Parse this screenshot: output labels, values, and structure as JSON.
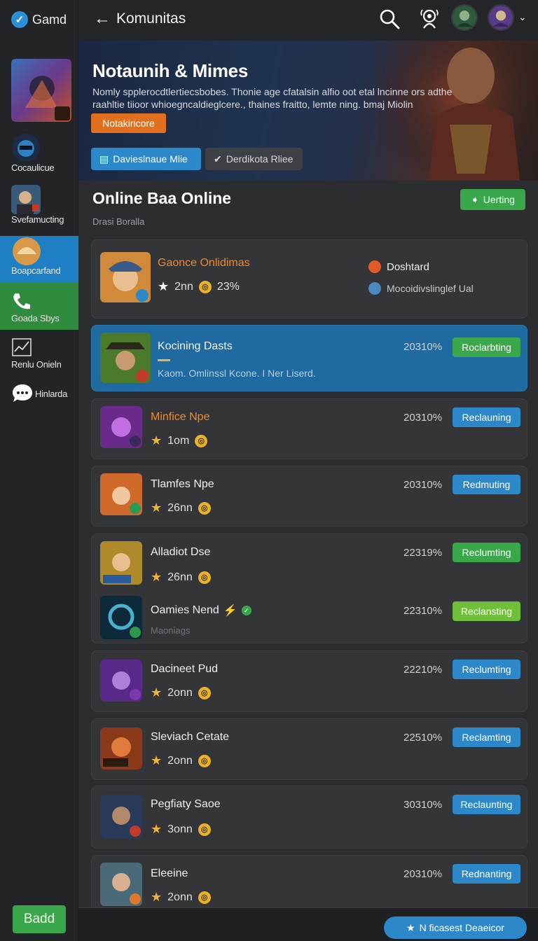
{
  "app": {
    "brand": "Gamd"
  },
  "sidebar": {
    "items": [
      {
        "label": ""
      },
      {
        "label": "Cocaulicue"
      },
      {
        "label": "Svefamucting"
      },
      {
        "label": "Boapcarfand"
      },
      {
        "label": "Goada Sbys"
      },
      {
        "label": "Renlu Onieln"
      },
      {
        "label": "Hinlarda"
      }
    ],
    "bottom_button": "Badd"
  },
  "header": {
    "title": "Komunitas"
  },
  "hero": {
    "title": "Notaunih & Mimes",
    "description": "Nomly spplerocdtlertiecsbobes. Thonie age cfatalsin alfio oot etal lncinne ors adthe raahltie tiioor whioegncaldieglcere., thaines fraitto, lemte ning. bmaj Miolin",
    "tag": "Notakiricore",
    "button_primary": "Davieslnaue Mlie",
    "button_secondary": "Derdikota Rliee"
  },
  "section": {
    "title": "Online Baa Online",
    "subtitle": "Drasi Boralla",
    "action": "Uerting"
  },
  "featured": {
    "name": "Gaonce Onlidimas",
    "rating": "2nn",
    "percent": "23%",
    "side_title": "Doshtard",
    "side_sub": "Mocoidivslinglef  Ual"
  },
  "games": [
    {
      "name": "Kocining Dasts",
      "percent": "20310%",
      "action": "Roclarbting",
      "sub": "Kaom. Omlinssl Kcone. I Ner Liserd."
    },
    {
      "name": "Minfice Npe",
      "rating": "1om",
      "percent": "20310%",
      "action": "Reclauning"
    },
    {
      "name": "Tlamfes Npe",
      "rating": "26nn",
      "percent": "20310%",
      "action": "Redmuting"
    },
    {
      "name": "Alladiot Dse",
      "rating": "26nn",
      "percent": "22319%",
      "action": "Reclumting"
    },
    {
      "name": "Oamies Nend",
      "percent": "22310%",
      "action": "Reclansting",
      "sub": "Maoniags"
    },
    {
      "name": "Dacineet Pud",
      "rating": "2onn",
      "percent": "22210%",
      "action": "Reclumting"
    },
    {
      "name": "Sleviach Cetate",
      "rating": "2onn",
      "percent": "22510%",
      "action": "Reclamting"
    },
    {
      "name": "Pegfiaty Saoe",
      "rating": "3onn",
      "percent": "30310%",
      "action": "Reclaunting"
    },
    {
      "name": "Eleeine",
      "rating": "2onn",
      "percent": "20310%",
      "action": "Rednanting"
    }
  ],
  "footer": {
    "button": "N ficasest Deaeicor"
  }
}
